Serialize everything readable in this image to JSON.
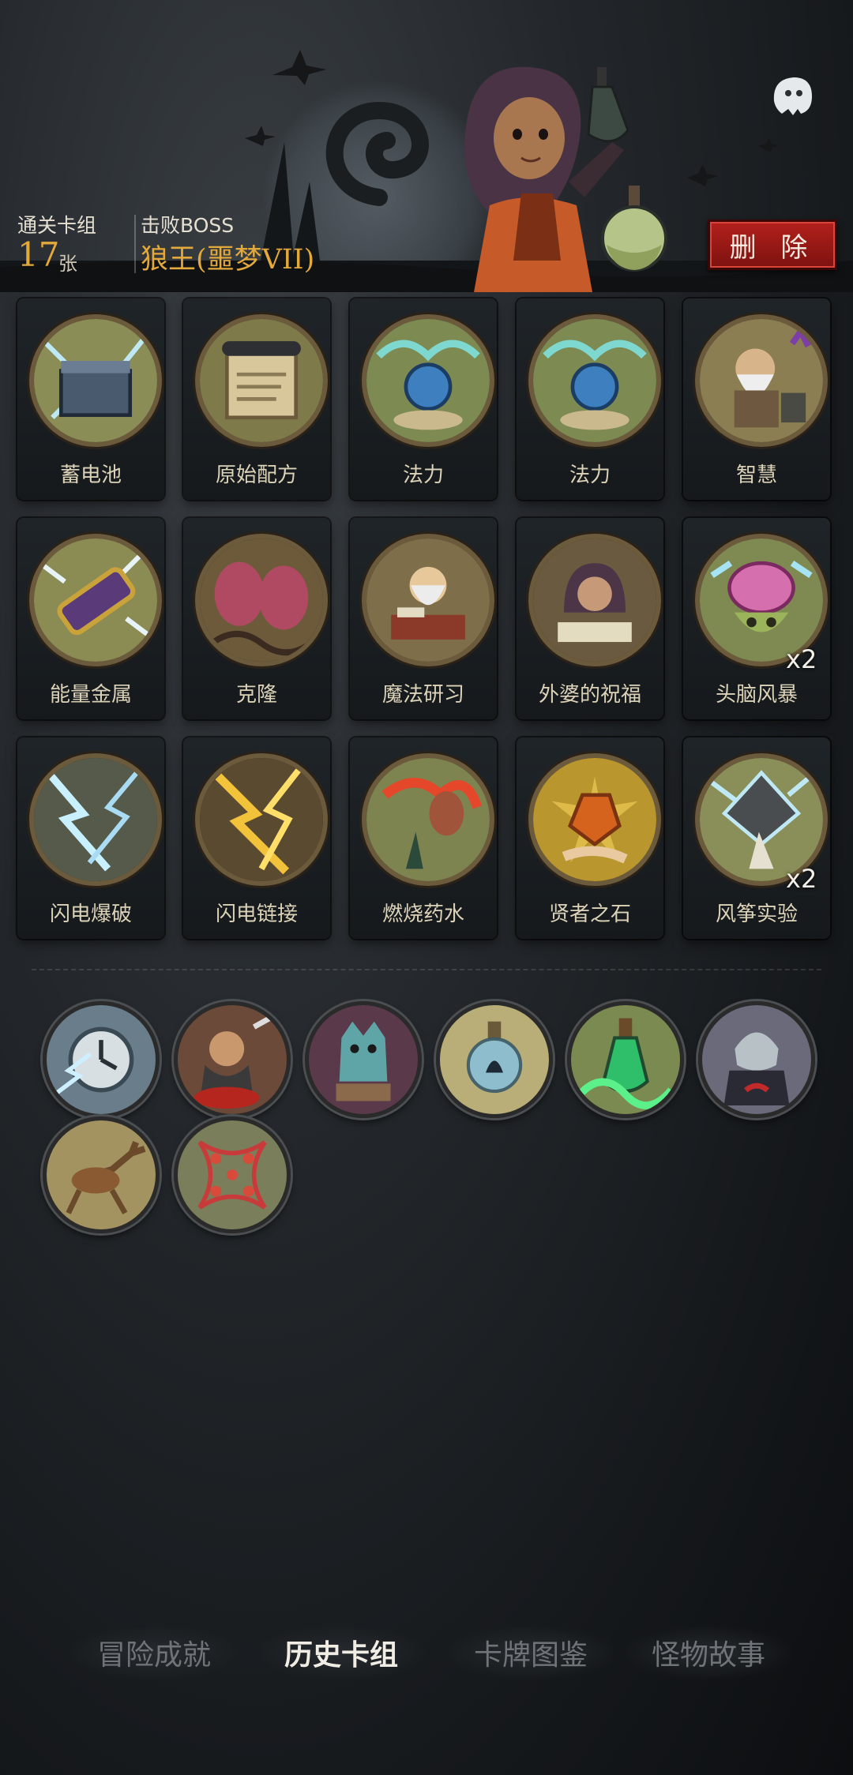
{
  "header": {
    "cleared_deck_label": "通关卡组",
    "card_count": "17",
    "card_unit": "张",
    "defeated_boss_label": "击败BOSS",
    "boss_name": "狼王(噩梦VII)",
    "delete_button": "删 除",
    "ghost_icon": "ghost-icon"
  },
  "cards": [
    {
      "name": "蓄电池",
      "icon": "battery-box-icon"
    },
    {
      "name": "原始配方",
      "icon": "scroll-icon"
    },
    {
      "name": "法力",
      "icon": "mana-orb-icon"
    },
    {
      "name": "法力",
      "icon": "mana-orb-icon"
    },
    {
      "name": "智慧",
      "icon": "old-sage-icon"
    },
    {
      "name": "能量金属",
      "icon": "energy-metal-icon"
    },
    {
      "name": "克隆",
      "icon": "clone-pods-icon"
    },
    {
      "name": "魔法研习",
      "icon": "magic-study-icon"
    },
    {
      "name": "外婆的祝福",
      "icon": "grandma-icon"
    },
    {
      "name": "头脑风暴",
      "icon": "brain-icon",
      "count": "x2"
    },
    {
      "name": "闪电爆破",
      "icon": "lightning-blast-icon"
    },
    {
      "name": "闪电链接",
      "icon": "lightning-chain-icon"
    },
    {
      "name": "燃烧药水",
      "icon": "burning-potion-icon"
    },
    {
      "name": "贤者之石",
      "icon": "philosopher-stone-icon"
    },
    {
      "name": "风筝实验",
      "icon": "kite-experiment-icon",
      "count": "x2"
    }
  ],
  "relics": [
    {
      "icon": "clock-lightning-icon"
    },
    {
      "icon": "cook-with-knife-icon"
    },
    {
      "icon": "gargoyle-statue-icon"
    },
    {
      "icon": "bottled-spirit-icon"
    },
    {
      "icon": "green-potion-icon"
    },
    {
      "icon": "vampire-icon"
    },
    {
      "icon": "leaping-deer-icon"
    },
    {
      "icon": "dna-helix-icon"
    }
  ],
  "nav": {
    "tabs": [
      "冒险成就",
      "历史卡组",
      "卡牌图鉴",
      "怪物故事"
    ],
    "active_index": 1
  },
  "colors": {
    "accent_gold": "#e3a93b",
    "delete_red": "#b3201c",
    "card_art_bg": "#8a8a5a"
  }
}
